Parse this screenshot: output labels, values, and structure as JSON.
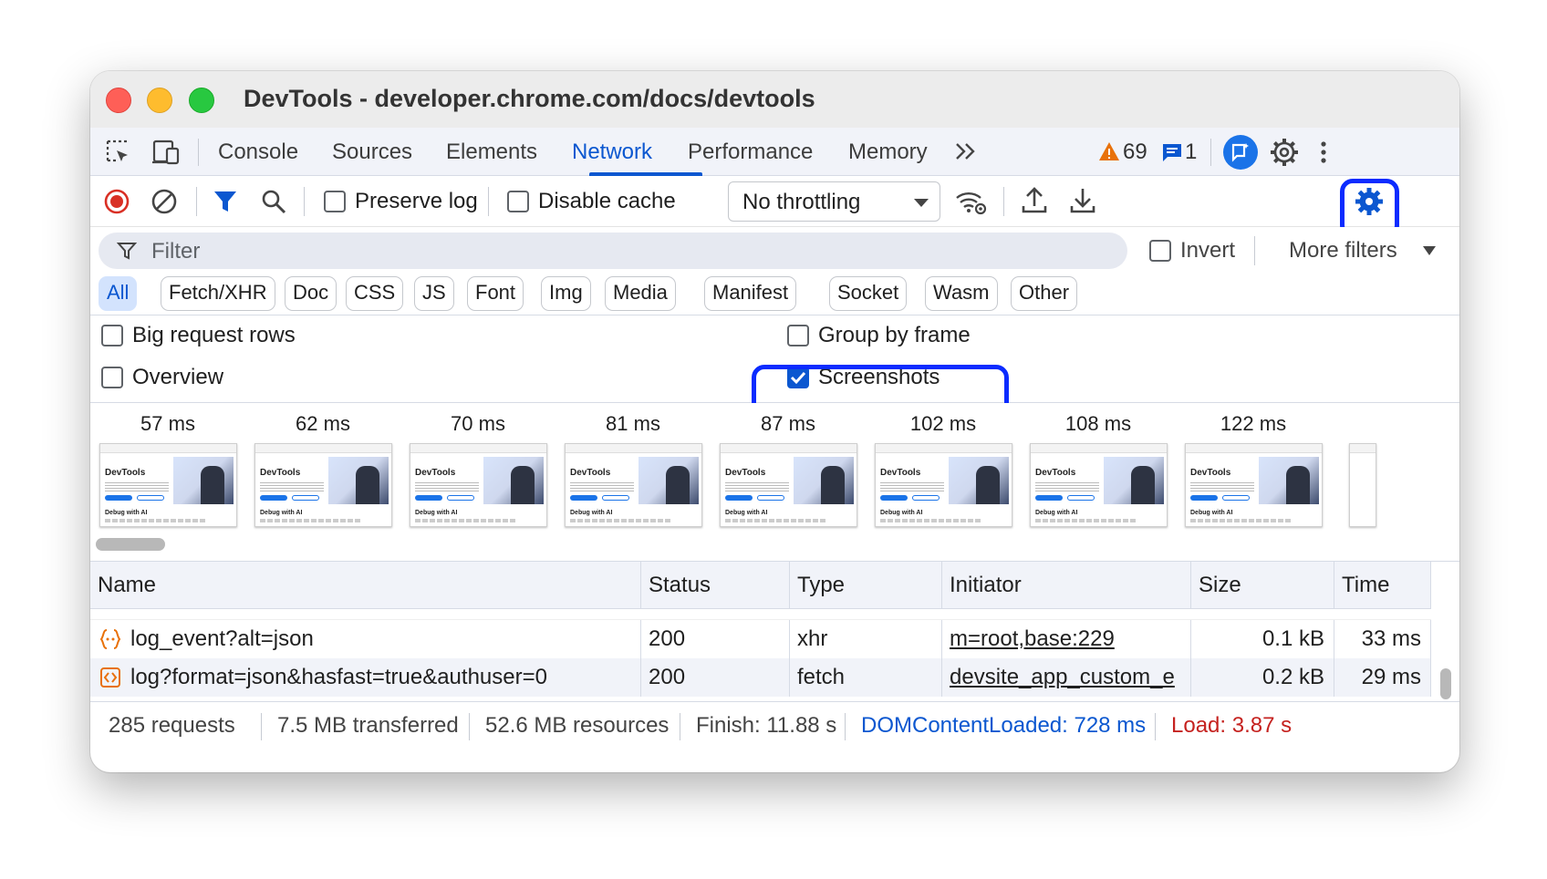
{
  "window": {
    "title": "DevTools - developer.chrome.com/docs/devtools"
  },
  "tabs": {
    "items": [
      "Console",
      "Sources",
      "Elements",
      "Network",
      "Performance",
      "Memory"
    ],
    "active": "Network",
    "more_icon": "chevron-double-right-icon",
    "warnings_count": "69",
    "messages_count": "1"
  },
  "toolbar": {
    "preserve_log_label": "Preserve log",
    "preserve_log_checked": false,
    "disable_cache_label": "Disable cache",
    "disable_cache_checked": false,
    "throttling_value": "No throttling"
  },
  "filter": {
    "placeholder": "Filter",
    "invert_label": "Invert",
    "more_filters_label": "More filters"
  },
  "type_filters": {
    "items": [
      "All",
      "Fetch/XHR",
      "Doc",
      "CSS",
      "JS",
      "Font",
      "Img",
      "Media",
      "Manifest",
      "Socket",
      "Wasm",
      "Other"
    ],
    "active": "All"
  },
  "settings": {
    "big_request_rows_label": "Big request rows",
    "big_request_rows_checked": false,
    "overview_label": "Overview",
    "overview_checked": false,
    "group_by_frame_label": "Group by frame",
    "group_by_frame_checked": false,
    "screenshots_label": "Screenshots",
    "screenshots_checked": true
  },
  "screenshots": {
    "frames": [
      "57 ms",
      "62 ms",
      "70 ms",
      "81 ms",
      "87 ms",
      "102 ms",
      "108 ms",
      "122 ms"
    ],
    "thumb_heading": "DevTools",
    "thumb_footer": "Debug with AI"
  },
  "table": {
    "columns": [
      "Name",
      "Status",
      "Type",
      "Initiator",
      "Size",
      "Time"
    ],
    "rows": [
      {
        "icon": "xhr-braces-icon",
        "name": "log_event?alt=json",
        "status": "200",
        "type": "xhr",
        "initiator": "m=root,base:229",
        "size": "0.1 kB",
        "time": "33 ms"
      },
      {
        "icon": "fetch-icon",
        "name": "log?format=json&hasfast=true&authuser=0",
        "status": "200",
        "type": "fetch",
        "initiator": "devsite_app_custom_e",
        "size": "0.2 kB",
        "time": "29 ms"
      }
    ]
  },
  "status_bar": {
    "requests": "285 requests",
    "transferred": "7.5 MB transferred",
    "resources": "52.6 MB resources",
    "finish": "Finish: 11.88 s",
    "dom_content_loaded": "DOMContentLoaded: 728 ms",
    "load": "Load: 3.87 s"
  },
  "colors": {
    "accent": "#0b57d0",
    "highlight": "#0b2bff",
    "warning": "#e8710a",
    "error": "#c5221f",
    "record": "#d93025"
  }
}
